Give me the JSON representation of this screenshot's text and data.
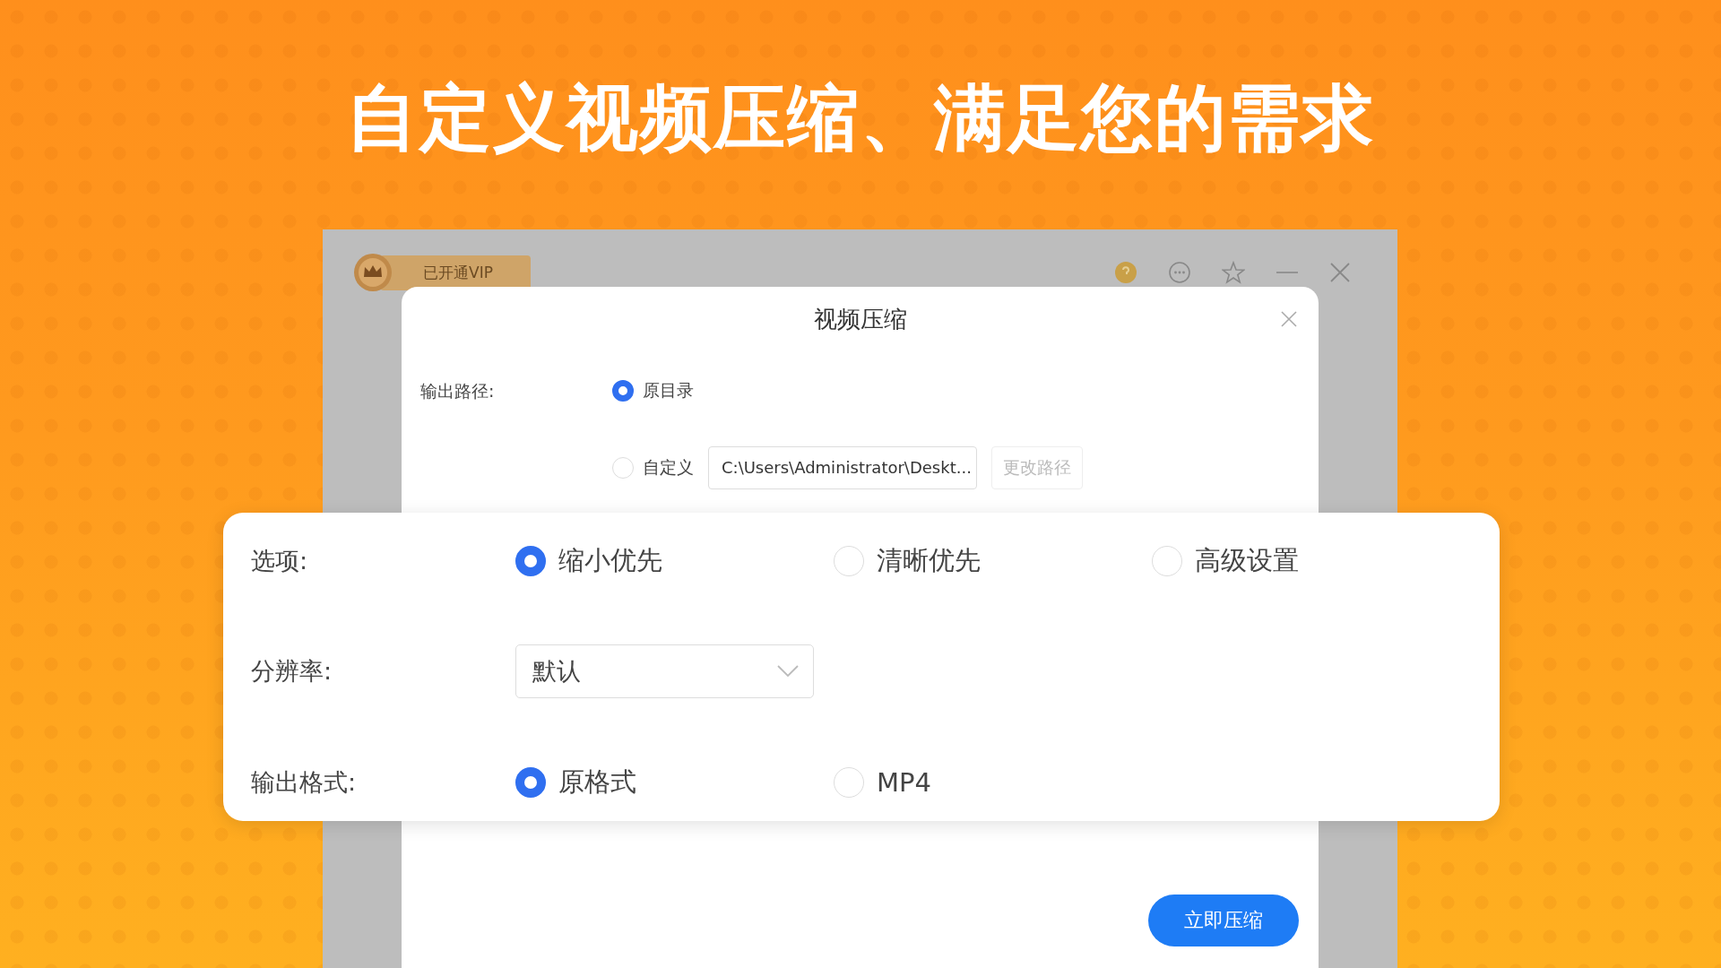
{
  "headline": "自定义视频压缩、满足您的需求",
  "window": {
    "vip_badge": "已开通VIP"
  },
  "dialog": {
    "title": "视频压缩",
    "output_path": {
      "label": "输出路径:",
      "options": [
        {
          "label": "原目录",
          "selected": true
        },
        {
          "label": "自定义",
          "selected": false
        }
      ],
      "path_value": "C:\\Users\\Administrator\\Deskt...",
      "change_button": "更改路径"
    },
    "submit_button": "立即压缩"
  },
  "options_card": {
    "rows": [
      {
        "kind": "radio",
        "label": "选项:",
        "options": [
          {
            "label": "缩小优先",
            "selected": true
          },
          {
            "label": "清晰优先",
            "selected": false
          },
          {
            "label": "高级设置",
            "selected": false
          }
        ]
      },
      {
        "kind": "select",
        "label": "分辨率:",
        "value": "默认"
      },
      {
        "kind": "radio",
        "label": "输出格式:",
        "options": [
          {
            "label": "原格式",
            "selected": true
          },
          {
            "label": "MP4",
            "selected": false
          }
        ]
      }
    ]
  }
}
